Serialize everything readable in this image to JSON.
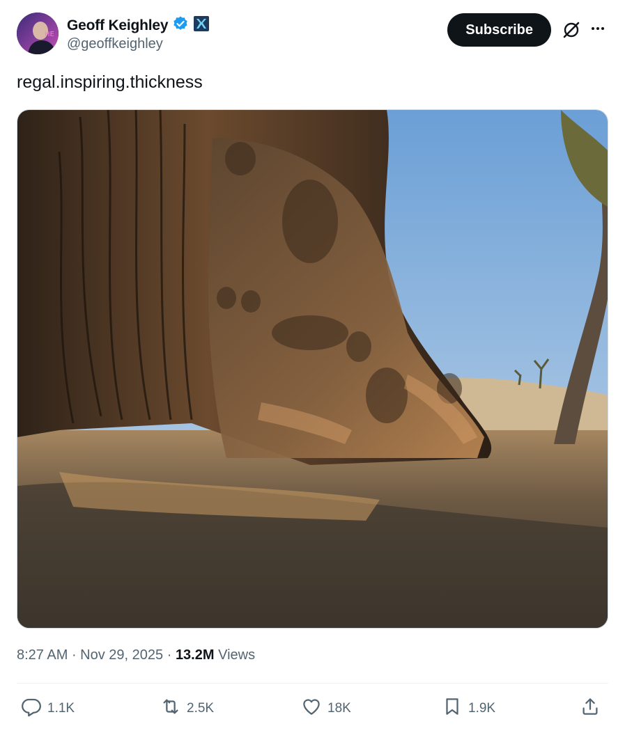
{
  "author": {
    "display_name": "Geoff Keighley",
    "handle": "@geoffkeighley",
    "verified_icon": "verified-badge-icon",
    "affiliate_icon": "affiliate-badge-icon"
  },
  "header": {
    "subscribe_label": "Subscribe",
    "grok_icon": "grok-icon",
    "more_icon": "more-icon"
  },
  "tweet": {
    "text": "regal.inspiring.thickness",
    "media_icon": "photo-carved-tree-sculpture-desert"
  },
  "meta": {
    "time": "8:27 AM",
    "sep1": " · ",
    "date": "Nov 29, 2025",
    "sep2": " · ",
    "views_count": "13.2M",
    "views_label": " Views"
  },
  "actions": {
    "replies": "1.1K",
    "reposts": "2.5K",
    "likes": "18K",
    "bookmarks": "1.9K"
  },
  "colors": {
    "text": "#0f1419",
    "secondary": "#536471",
    "verified": "#1d9bf0",
    "sky": "#8fb7e0"
  }
}
